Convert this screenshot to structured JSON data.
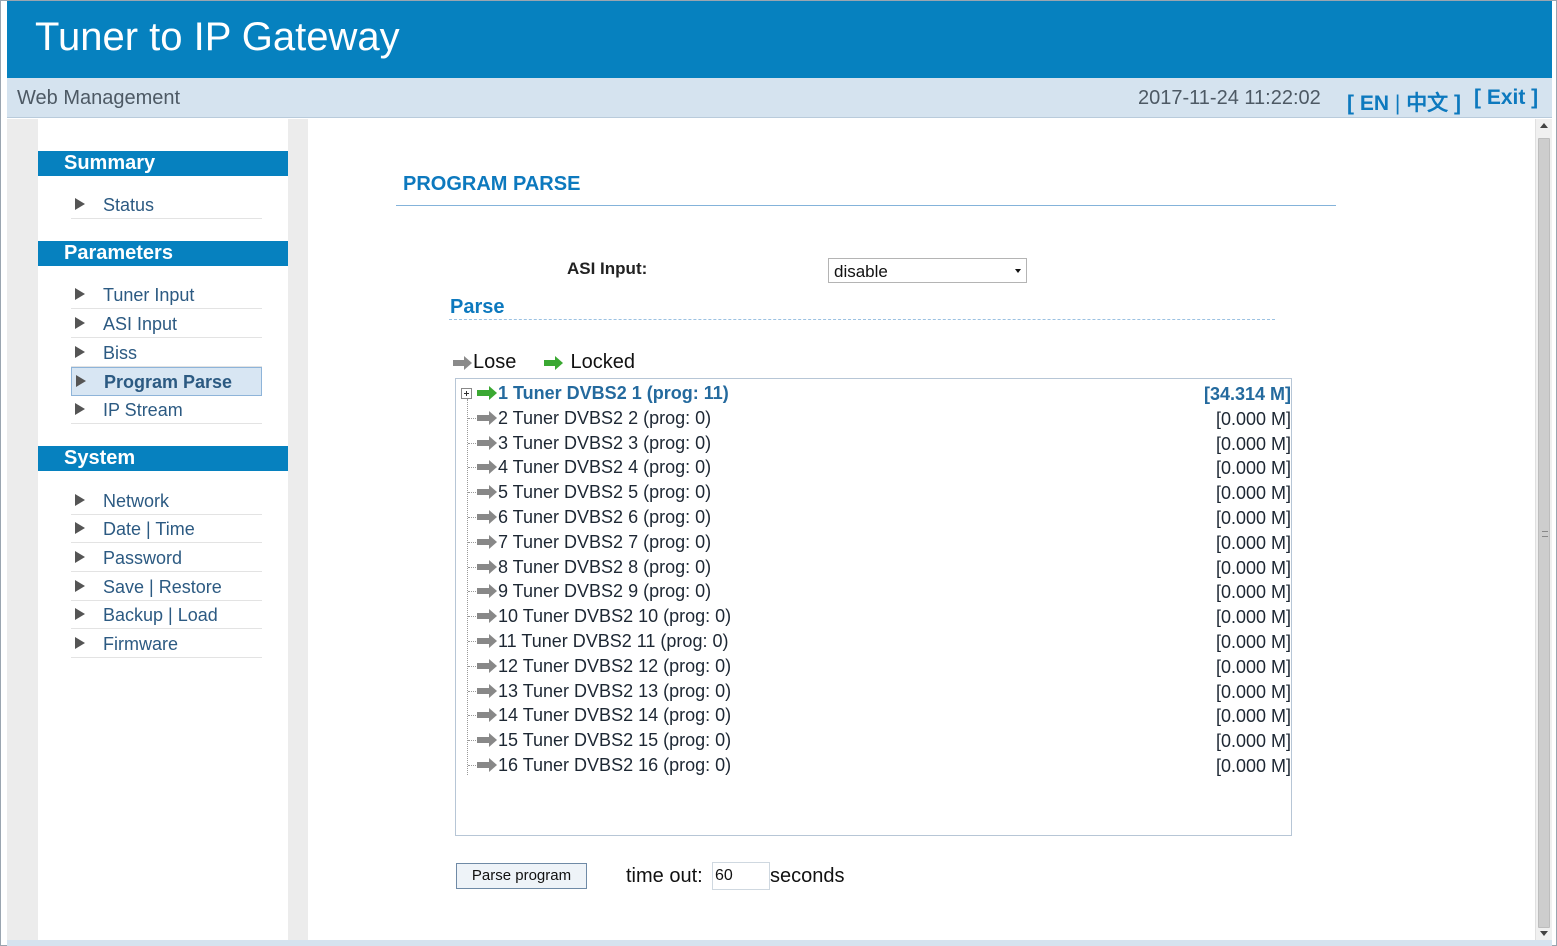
{
  "header": {
    "title": "Tuner to IP Gateway"
  },
  "subbar": {
    "title": "Web Management",
    "datetime": "2017-11-24 11:22:02",
    "lang_open": "[",
    "lang_en": "EN",
    "lang_sep": "|",
    "lang_cn": "中文",
    "lang_close": "]",
    "exit_label": "[ Exit ]"
  },
  "sidebar": {
    "sections": [
      {
        "title": "Summary",
        "items": [
          {
            "label": "Status"
          }
        ]
      },
      {
        "title": "Parameters",
        "items": [
          {
            "label": "Tuner Input"
          },
          {
            "label": "ASI Input"
          },
          {
            "label": "Biss"
          },
          {
            "label": "Program Parse",
            "active": true
          },
          {
            "label": "IP Stream"
          }
        ]
      },
      {
        "title": "System",
        "items": [
          {
            "label": "Network"
          },
          {
            "label": "Date | Time"
          },
          {
            "label": "Password"
          },
          {
            "label": "Save | Restore"
          },
          {
            "label": "Backup | Load"
          },
          {
            "label": "Firmware"
          }
        ]
      }
    ]
  },
  "main": {
    "page_title": "PROGRAM PARSE",
    "asi_input_label": "ASI Input:",
    "asi_input_value": "disable",
    "parse_heading": "Parse",
    "legend": {
      "lose": "Lose",
      "locked": "Locked"
    },
    "tree_rows": [
      {
        "label": "1 Tuner DVBS2 1 (prog: 11)",
        "rate": "[34.314 M]",
        "status": "locked"
      },
      {
        "label": "2 Tuner DVBS2 2 (prog: 0)",
        "rate": "[0.000 M]",
        "status": "lose"
      },
      {
        "label": "3 Tuner DVBS2 3 (prog: 0)",
        "rate": "[0.000 M]",
        "status": "lose"
      },
      {
        "label": "4 Tuner DVBS2 4 (prog: 0)",
        "rate": "[0.000 M]",
        "status": "lose"
      },
      {
        "label": "5 Tuner DVBS2 5 (prog: 0)",
        "rate": "[0.000 M]",
        "status": "lose"
      },
      {
        "label": "6 Tuner DVBS2 6 (prog: 0)",
        "rate": "[0.000 M]",
        "status": "lose"
      },
      {
        "label": "7 Tuner DVBS2 7 (prog: 0)",
        "rate": "[0.000 M]",
        "status": "lose"
      },
      {
        "label": "8 Tuner DVBS2 8 (prog: 0)",
        "rate": "[0.000 M]",
        "status": "lose"
      },
      {
        "label": "9 Tuner DVBS2 9 (prog: 0)",
        "rate": "[0.000 M]",
        "status": "lose"
      },
      {
        "label": "10 Tuner DVBS2 10 (prog: 0)",
        "rate": "[0.000 M]",
        "status": "lose"
      },
      {
        "label": "11 Tuner DVBS2 11 (prog: 0)",
        "rate": "[0.000 M]",
        "status": "lose"
      },
      {
        "label": "12 Tuner DVBS2 12 (prog: 0)",
        "rate": "[0.000 M]",
        "status": "lose"
      },
      {
        "label": "13 Tuner DVBS2 13 (prog: 0)",
        "rate": "[0.000 M]",
        "status": "lose"
      },
      {
        "label": "14 Tuner DVBS2 14 (prog: 0)",
        "rate": "[0.000 M]",
        "status": "lose"
      },
      {
        "label": "15 Tuner DVBS2 15 (prog: 0)",
        "rate": "[0.000 M]",
        "status": "lose"
      },
      {
        "label": "16 Tuner DVBS2 16 (prog: 0)",
        "rate": "[0.000 M]",
        "status": "lose"
      }
    ],
    "parse_button": "Parse program",
    "timeout_label": "time out:",
    "timeout_value": "60",
    "seconds_label": "seconds"
  },
  "icons": {
    "lose_arrow": "gray-arrow-icon",
    "locked_arrow": "green-arrow-icon",
    "nav_bullet": "triangle-right-icon",
    "expander": "plus-box-icon"
  },
  "colors": {
    "header_blue": "#0681bf",
    "subbar_bg": "#d5e3ef",
    "link_blue": "#0d79be",
    "locked_green": "#3aa832",
    "lose_gray": "#888888"
  }
}
